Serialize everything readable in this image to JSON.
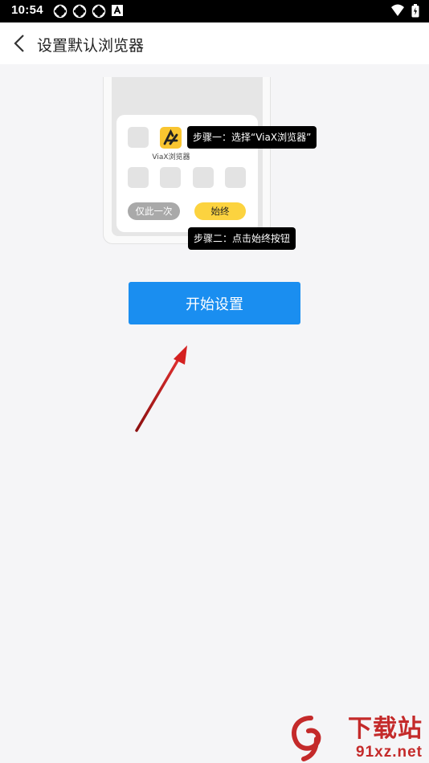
{
  "status_bar": {
    "time": "10:54",
    "left_icons": [
      "notification-icon",
      "notification-icon",
      "notification-icon",
      "app-a-icon"
    ],
    "right_icons": [
      "wifi-icon",
      "battery-charging-icon"
    ]
  },
  "app_bar": {
    "title": "设置默认浏览器",
    "back_icon": "chevron-left-icon"
  },
  "illustration": {
    "app_label": "ViaX浏览器",
    "once_button": "仅此一次",
    "always_button": "始终",
    "step1_text": "步骤一：选择“ViaX浏览器”",
    "step2_text": "步骤二：点击始终按钮",
    "accent_color": "#fcd33f"
  },
  "main": {
    "start_button": "开始设置",
    "button_color": "#1a8ef0"
  },
  "watermark": {
    "text_top": "下载站",
    "text_bottom": "91xz.net",
    "color": "#c42a2a"
  }
}
